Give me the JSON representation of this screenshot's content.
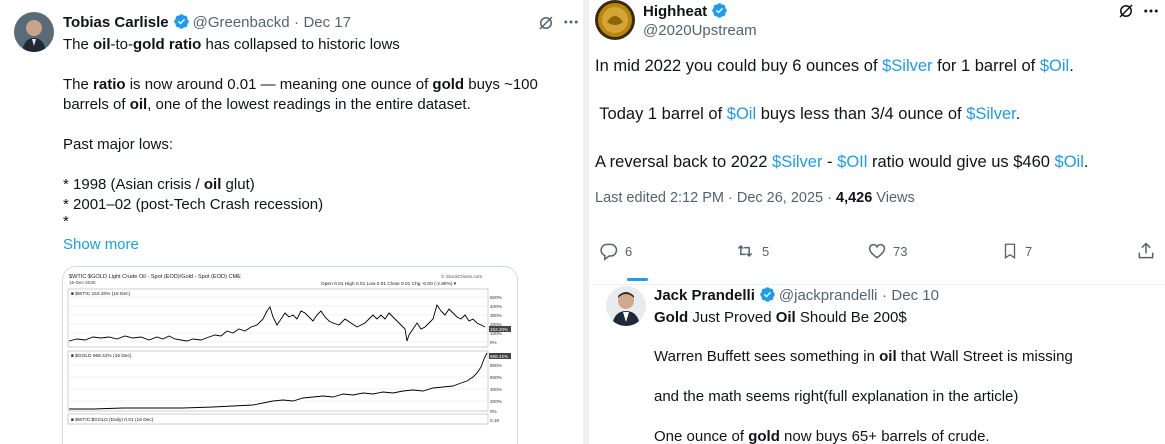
{
  "left_tweet": {
    "author_name": "Tobias Carlisle",
    "handle": "@Greenbackd",
    "dot": "·",
    "date": "Dec 17",
    "line1": {
      "pre": "The ",
      "b1": "oil",
      "mid1": "-to-",
      "b2": "gold",
      "mid2": " ",
      "b3": "ratio",
      "post": " has collapsed to historic lows"
    },
    "line2": {
      "pre": "The ",
      "b1": "ratio",
      "mid1": " is now around 0.01 — meaning one ounce of ",
      "b2": "gold",
      "post": " buys ~100"
    },
    "line3": {
      "pre": "barrels of ",
      "b1": "oil",
      "post": ", one of the lowest readings in the entire dataset."
    },
    "line4": "Past major lows:",
    "line5": {
      "pre": "* 1998 (Asian crisis / ",
      "b1": "oil",
      "post": " glut)"
    },
    "line6": "* 2001–02 (post-Tech Crash recession)",
    "line7": "*",
    "show_more": "Show more",
    "chart": {
      "title": "$WTIC:$GOLD Light Crude Oil - Spot (EOD)/Gold - Spot (EOD) CME",
      "date": "15-Dec-2025",
      "watermark": "© StockCharts.com",
      "ohlc": "Open 0.01  High 0.01  Low 0.01  Close 0.01  Chg -0.00 (-2.86%) ▾",
      "legend1": "■ $WTIC 153.20% (16 Dec)",
      "legend2": "■ $GOLD 968.42% (16 Dec)",
      "legend3": "■ $WTIC:$GOLD (Daily) 0.01 (16 Dec)",
      "upper_ticks": [
        "500%",
        "400%",
        "300%",
        "200%",
        "100%",
        "0%"
      ],
      "lower_ticks": [
        "800%",
        "600%",
        "400%",
        "200%",
        "0%"
      ],
      "tag1": "153.20%",
      "tag2": "968.42%",
      "bottom_tick": "0.18"
    }
  },
  "right_tweet": {
    "author_name": "Highheat",
    "handle": "@2020Upstream",
    "line1": {
      "pre": "In mid 2022 you could buy 6 ounces of ",
      "link1": "$Silver",
      "mid": " for 1 barrel of ",
      "link2": "$Oil",
      "post": "."
    },
    "line2": {
      "pre": " Today 1 barrel of ",
      "link1": "$Oil",
      "mid": " buys less than 3/4 ounce of ",
      "link2": "$Silver",
      "post": "."
    },
    "line3": {
      "pre": "A reversal back to 2022 ",
      "link1": "$Silver",
      "mid1": " - ",
      "link2": "$OIl",
      "mid2": " ratio would give us $460 ",
      "link3": "$Oil",
      "post": "."
    },
    "meta_prefix": "Last edited 2:12 PM · Dec 26, 2025 · ",
    "views_count": "4,426",
    "views_label": " Views",
    "actions": {
      "replies": "6",
      "reposts": "5",
      "likes": "73",
      "bookmarks": "7"
    }
  },
  "quoted_tweet": {
    "author_name": "Jack Prandelli",
    "handle": "@jackprandelli",
    "dot": "·",
    "date": "Dec 10",
    "title": {
      "b1": "Gold",
      "mid1": " Just Proved ",
      "b2": "Oil",
      "post": " Should Be 200$"
    },
    "line1": {
      "pre": "Warren Buffett sees something in ",
      "b1": "oil",
      "post": " that Wall Street is missing"
    },
    "line2": "and the math seems right(full explanation in the article)",
    "line3": {
      "pre": "One ounce of ",
      "b1": "gold",
      "post": " now buys 65+ barrels of crude."
    }
  },
  "colors": {
    "accent": "#1d9bf0",
    "text": "#0f1419",
    "muted": "#536471",
    "chart_line": "#000000"
  },
  "icons": [
    "verified-badge-icon",
    "grok-icon",
    "more-icon",
    "reply-icon",
    "repost-icon",
    "like-icon",
    "bookmark-icon",
    "share-icon"
  ]
}
